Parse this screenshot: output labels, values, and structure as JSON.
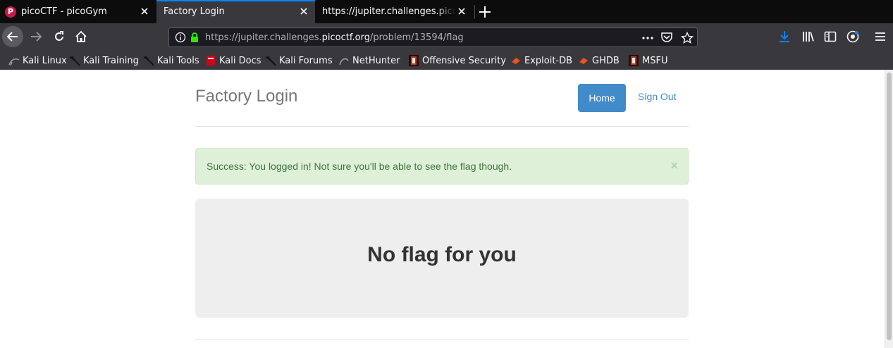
{
  "browser": {
    "tabs": [
      {
        "title": "picoCTF - picoGym",
        "favicon": "picoctf-icon",
        "active": false
      },
      {
        "title": "Factory Login",
        "favicon": "",
        "active": true
      },
      {
        "title": "https://jupiter.challenges.picoctf.org/problem/13594/flag",
        "favicon": "",
        "active": false
      }
    ],
    "url": {
      "prefix": "https://jupiter.challenges.",
      "domain": "picoctf.org",
      "path": "/problem/13594/flag"
    },
    "bookmarks": [
      {
        "label": "Kali Linux",
        "icon": "kali-dragon-icon"
      },
      {
        "label": "Kali Training",
        "icon": "kali-dragon-icon"
      },
      {
        "label": "Kali Tools",
        "icon": "kali-dragon-icon"
      },
      {
        "label": "Kali Docs",
        "icon": "kali-docs-icon"
      },
      {
        "label": "Kali Forums",
        "icon": "kali-dragon-icon"
      },
      {
        "label": "NetHunter",
        "icon": "nethunter-icon"
      },
      {
        "label": "Offensive Security",
        "icon": "offsec-icon"
      },
      {
        "label": "Exploit-DB",
        "icon": "exploit-db-icon"
      },
      {
        "label": "GHDB",
        "icon": "ghdb-icon"
      },
      {
        "label": "MSFU",
        "icon": "msfu-icon"
      }
    ],
    "colors": {
      "accent": "#0a84ff",
      "toolbar": "#38383d",
      "tabstrip": "#0c0c0d"
    }
  },
  "page": {
    "brand": "Factory Login",
    "nav": {
      "home": "Home",
      "sign_out": "Sign Out"
    },
    "alert": {
      "message": "Success: You logged in! Not sure you'll be able to see the flag though.",
      "close": "×"
    },
    "jumbotron": {
      "heading": "No flag for you"
    },
    "colors": {
      "primary": "#428bca",
      "success_bg": "#dff0d8",
      "success_text": "#3c763d"
    }
  }
}
